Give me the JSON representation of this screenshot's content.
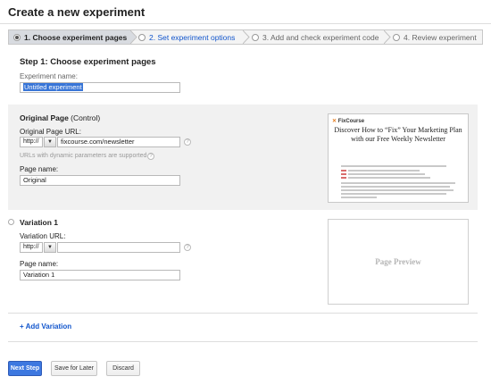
{
  "page": {
    "title": "Create a new experiment"
  },
  "stepper": {
    "steps": [
      {
        "label": "1. Choose experiment pages",
        "state": "active"
      },
      {
        "label": "2. Set experiment options",
        "state": "link"
      },
      {
        "label": "3. Add and check experiment code",
        "state": "muted"
      },
      {
        "label": "4. Review experiment",
        "state": "muted"
      }
    ]
  },
  "step1": {
    "heading": "Step 1: Choose experiment pages",
    "experiment_name_label": "Experiment name:",
    "experiment_name_value": "Untitled experiment"
  },
  "original": {
    "title": "Original Page",
    "title_suffix": "(Control)",
    "url_label": "Original Page URL:",
    "protocol": "http://",
    "url_value": "fixcourse.com/newsletter",
    "hint": "URLs with dynamic parameters are supported",
    "page_name_label": "Page name:",
    "page_name_value": "Original",
    "help_glyph": "?",
    "preview": {
      "logo_mark": "✕",
      "logo_text": "FixCourse",
      "headline": "Discover How to “Fix” Your Marketing Plan with our Free Weekly Newsletter"
    }
  },
  "variation": {
    "title": "Variation 1",
    "url_label": "Variation URL:",
    "protocol": "http://",
    "url_value": "",
    "page_name_label": "Page name:",
    "page_name_value": "Variation 1",
    "help_glyph": "?",
    "preview_label": "Page Preview"
  },
  "add_variation": {
    "label": "+ Add Variation"
  },
  "footer": {
    "next_label": "Next Step",
    "save_label": "Save for Later",
    "discard_label": "Discard"
  },
  "icons": {
    "dropdown_arrow": "▼"
  },
  "colors": {
    "link": "#1155cc",
    "primary_button": "#3d78e0",
    "band_background": "#f1f1f1",
    "selection": "#3875d7"
  }
}
